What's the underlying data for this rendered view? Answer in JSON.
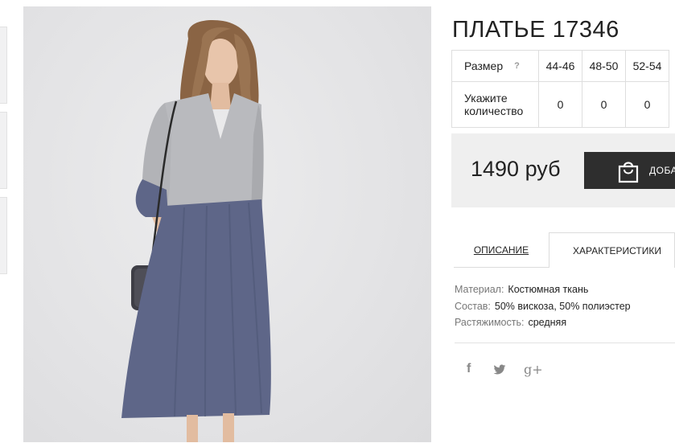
{
  "product": {
    "title": "ПЛАТЬЕ 17346"
  },
  "size_table": {
    "size_label": "Размер",
    "help_mark": "?",
    "sizes": [
      "44-46",
      "48-50",
      "52-54"
    ],
    "quantity_label": "Укажите количество",
    "quantities": [
      "0",
      "0",
      "0"
    ]
  },
  "price_block": {
    "price": "1490 руб",
    "cart_button_label": "ДОБА"
  },
  "tabs": {
    "description": "ОПИСАНИЕ",
    "characteristics": "ХАРАКТЕРИСТИКИ",
    "active": "characteristics"
  },
  "characteristics": [
    {
      "key": "Материал:",
      "value": "Костюмная ткань"
    },
    {
      "key": "Состав:",
      "value": "50% вискоза, 50% полиэстер"
    },
    {
      "key": "Растяжимость:",
      "value": "средняя"
    }
  ],
  "social": {
    "facebook": "f",
    "twitter": "twitter-icon",
    "googleplus": "g+"
  },
  "colors": {
    "button_bg": "#2e2e2e",
    "price_bg": "#efefef",
    "dress_top": "#b8b9bd",
    "dress_skirt": "#5e6688"
  }
}
